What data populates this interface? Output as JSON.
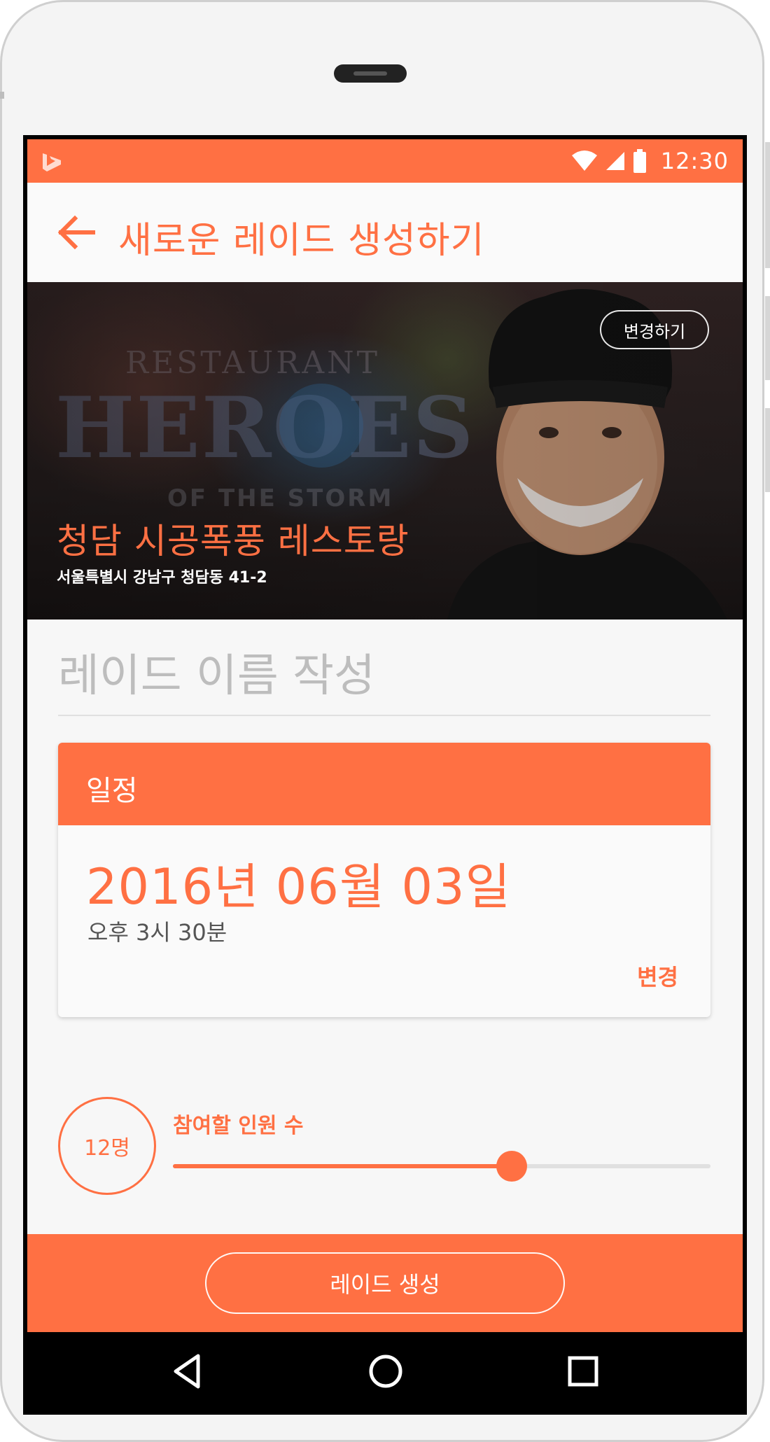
{
  "status_bar": {
    "time": "12:30",
    "icons": [
      "bing-logo-icon",
      "wifi-icon",
      "cellular-signal-icon",
      "battery-icon"
    ]
  },
  "app_bar": {
    "back_icon": "arrow-left-icon",
    "title": "새로운 레이드 생성하기"
  },
  "hero": {
    "change_button_label": "변경하기",
    "restaurant_name": "청담 시공폭풍 레스토랑",
    "address": "서울특별시 강남구 청담동 41-2",
    "image_text": "RESTAURANT HEROES OF THE STORM"
  },
  "raid_name": {
    "placeholder": "레이드 이름 작성",
    "value": ""
  },
  "schedule": {
    "header": "일정",
    "date": "2016년 06월 03일",
    "time": "오후 3시 30분",
    "change_label": "변경"
  },
  "participants": {
    "count_label": "12명",
    "label": "참여할 인원 수",
    "slider_fraction": 0.63
  },
  "action": {
    "create_label": "레이드 생성"
  },
  "nav": {
    "icons": [
      "back-triangle-icon",
      "home-circle-icon",
      "recents-square-icon"
    ]
  },
  "colors": {
    "accent": "#ff7043",
    "background": "#f7f7f7",
    "hint_text": "#bdbdbd",
    "secondary_text": "#555555"
  }
}
